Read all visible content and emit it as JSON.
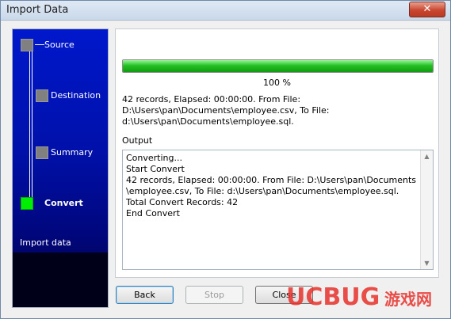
{
  "window": {
    "title": "Import Data",
    "close_glyph": "✕"
  },
  "steps": [
    {
      "label": "Source",
      "active": false
    },
    {
      "label": "Destination",
      "active": false
    },
    {
      "label": "Summary",
      "active": false
    },
    {
      "label": "Convert",
      "active": true
    }
  ],
  "sidebar_footer": "Import data",
  "progress": {
    "percent": 100,
    "label": "100 %"
  },
  "info_lines": [
    "42 records,    Elapsed: 00:00:00.    From File:",
    "D:\\Users\\pan\\Documents\\employee.csv,    To File:",
    "d:\\Users\\pan\\Documents\\employee.sql."
  ],
  "output": {
    "label": "Output",
    "lines": [
      "Converting...",
      "Start Convert",
      "42 records,    Elapsed: 00:00:00.    From File: D:\\Users\\pan\\Documents",
      "\\employee.csv,    To File: d:\\Users\\pan\\Documents\\employee.sql.",
      "Total Convert Records: 42",
      "End Convert"
    ]
  },
  "buttons": {
    "back": "Back",
    "stop": "Stop",
    "close": "Close"
  },
  "watermark": {
    "brand": "UCBUG",
    "suffix": "游戏网"
  },
  "colors": {
    "progress_green": "#24c224",
    "active_step": "#00ee00",
    "sidebar_blue": "#0018cc"
  }
}
